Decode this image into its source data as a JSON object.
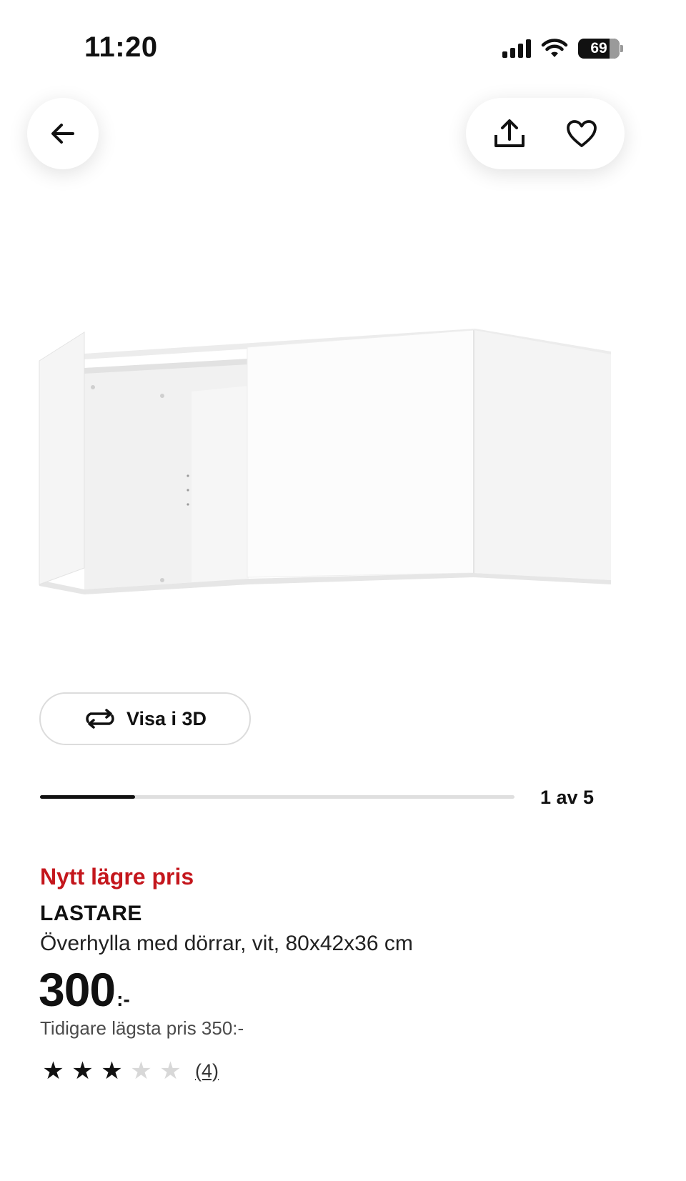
{
  "status": {
    "time": "11:20",
    "battery": "69"
  },
  "header": {
    "back_icon": "arrow-left-icon",
    "share_icon": "share-icon",
    "favorite_icon": "heart-icon"
  },
  "gallery": {
    "view_3d_label": "Visa i 3D",
    "view_3d_icon": "rotate-icon",
    "position_text": "1 av 5",
    "current": 1,
    "total": 5
  },
  "product": {
    "promo_label": "Nytt lägre pris",
    "name": "LASTARE",
    "description": "Överhylla med dörrar, vit, 80x42x36 cm",
    "price": "300",
    "price_suffix": ":-",
    "previous_price": "Tidigare lägsta pris 350:-"
  },
  "rating": {
    "value": 3,
    "max": 5,
    "review_count": "(4)"
  },
  "colors": {
    "promo": "#c4161c",
    "text": "#111111"
  }
}
